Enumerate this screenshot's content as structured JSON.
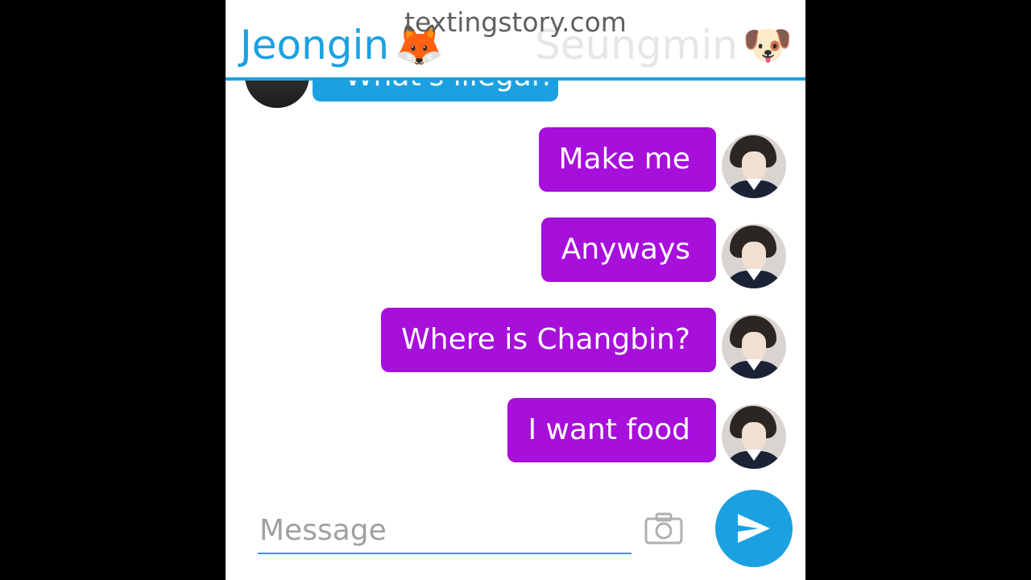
{
  "watermark": "textingstory.com",
  "header": {
    "left_name": "Jeongin",
    "left_emoji": "🦊",
    "right_name": "Seungmin",
    "right_emoji": "🐶"
  },
  "received_partial": "What's illegal?",
  "messages": [
    {
      "text": "Make me"
    },
    {
      "text": "Anyways"
    },
    {
      "text": "Where is Changbin?"
    },
    {
      "text": "I want food"
    }
  ],
  "compose": {
    "placeholder": "Message",
    "camera_icon": "camera-icon",
    "send_icon": "send-icon"
  },
  "colors": {
    "accent": "#1ba1e2",
    "sent_bubble": "#a70fdb",
    "background": "#000000"
  }
}
